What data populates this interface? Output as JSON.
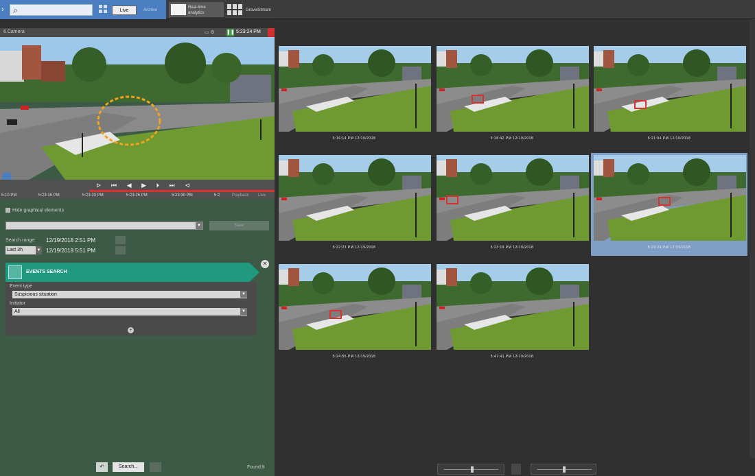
{
  "topbar": {
    "live_label": "Live",
    "archive_label": "Archive",
    "tab1_label": "Real-time analytics",
    "tab2_label": "GravelStream"
  },
  "camera": {
    "name": "6.Camera",
    "time": "5:23:24 PM",
    "timeline_ticks": [
      "5:10 PM",
      "5:23:15 PM",
      "5:23:20 PM",
      "5:23:25 PM",
      "5:23:30 PM",
      "5:2"
    ],
    "playback_label": "Playback",
    "live_label": "Live"
  },
  "search_panel": {
    "hide_label": "Hide graphical elements",
    "save_label": "Save",
    "range_label": "Search range:",
    "range_from": "12/19/2018  2:51 PM",
    "range_to": "12/19/2018  5:51 PM",
    "last_option": "Last 3h",
    "events_title": "EVENTS SEARCH",
    "event_type_label": "Event type",
    "event_type_value": "Suspicious situation",
    "initiator_label": "Initiator",
    "initiator_value": "All",
    "search_button": "Search...",
    "found_label": "Found:8"
  },
  "results": [
    {
      "time": "5:16:14 PM 12/19/2018"
    },
    {
      "time": "5:18:42 PM 12/19/2018"
    },
    {
      "time": "5:21:04 PM 12/19/2018"
    },
    {
      "time": "5:22:23 PM 12/19/2018"
    },
    {
      "time": "5:23:19 PM 12/19/2018"
    },
    {
      "time": "5:23:24 PM 12/19/2018"
    },
    {
      "time": "5:24:55 PM 12/19/2018"
    },
    {
      "time": "5:47:41 PM 12/19/2018"
    }
  ],
  "colors": {
    "accent": "#4b7fc1",
    "events_header": "#1f9a7f",
    "panel_green": "#3c5a45",
    "detection_red": "#d93030",
    "selected_thumb": "#7f9fc6"
  }
}
